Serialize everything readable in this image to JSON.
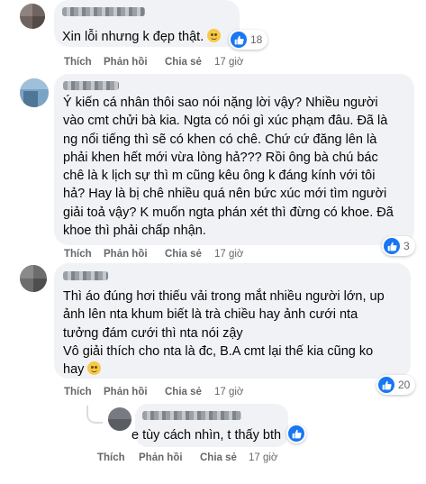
{
  "comments": [
    {
      "text": "Xin lỗi nhưng k đẹp thật.",
      "emoji": "smiling-face-emoji",
      "reactions": "18",
      "actions": {
        "like": "Thích",
        "reply": "Phản hồi",
        "share": "Chia sẻ",
        "time": "17 giờ"
      }
    },
    {
      "name": "Anh Nh...",
      "lines": [
        "Ý kiến cá nhân thôi sao nói nặng lời vậy? Nhiều người",
        "vào cmt chửi bà kia. Ngta có nói gì xúc phạm đâu. Đã là",
        "ng nổi tiếng thì sẽ có khen có chê. Chứ cứ đăng lên là",
        "phải khen hết mới vừa lòng hả??? Rồi ông bà chú bác",
        "chê là k lịch sự thì m cũng kêu ông k đáng kính với tôi",
        "hả? Hay là bị chê nhiều quá nên bức xúc mới tìm người",
        "giải toả vậy? K muốn ngta phán xét thì đừng có khoe. Đã",
        "khoe thì phải chấp nhận."
      ],
      "reactions": "3",
      "actions": {
        "like": "Thích",
        "reply": "Phản hồi",
        "share": "Chia sẻ",
        "time": "17 giờ"
      }
    },
    {
      "lines": [
        "Thì áo đúng hơi thiếu vải trong mắt nhiều người lớn, up",
        "ảnh lên nta khum biết là trà chiều hay ảnh cưới nta",
        "tưởng đám cưới thì nta nói zậy",
        "Vô giải thích cho nta là đc, B.A cmt lại thế kia cũng ko",
        "hay"
      ],
      "emoji": "smiling-face-emoji",
      "reactions": "20",
      "actions": {
        "like": "Thích",
        "reply": "Phản hồi",
        "share": "Chia sẻ",
        "time": "17 giờ"
      }
    },
    {
      "text": "e tùy cách nhìn, t thấy bth",
      "actions": {
        "like": "Thích",
        "reply": "Phản hồi",
        "share": "Chia sẻ",
        "time": "17 giờ"
      }
    }
  ],
  "colors": {
    "bubble": "#f0f2f5",
    "link": "#65676b",
    "like": "#1877f2"
  }
}
